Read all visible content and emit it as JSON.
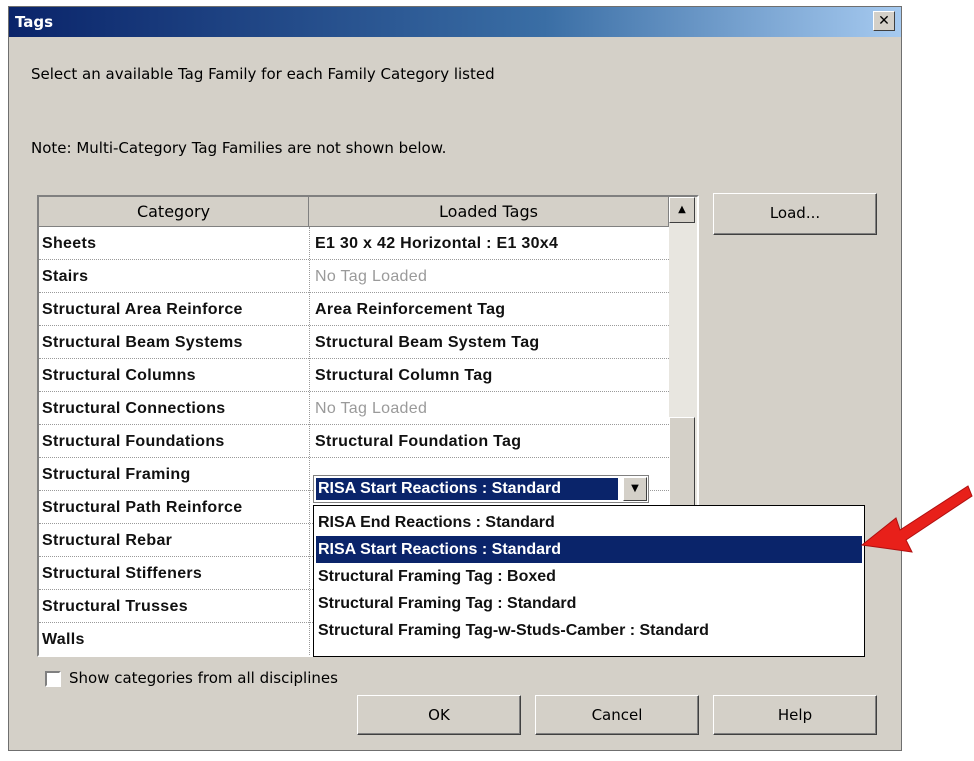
{
  "window": {
    "title": "Tags",
    "close_glyph": "✕"
  },
  "instructions": "Select an available Tag Family for each Family Category listed",
  "note": "Note: Multi-Category Tag Families are not shown below.",
  "table": {
    "headers": [
      "Category",
      "Loaded Tags"
    ],
    "rows": [
      {
        "category": "Sheets",
        "tag": "E1 30 x 42 Horizontal : E1 30x4"
      },
      {
        "category": "Stairs",
        "tag": "No Tag Loaded"
      },
      {
        "category": "Structural Area Reinforce",
        "tag": "Area Reinforcement Tag"
      },
      {
        "category": "Structural Beam Systems",
        "tag": "Structural Beam System Tag"
      },
      {
        "category": "Structural Columns",
        "tag": "Structural Column Tag"
      },
      {
        "category": "Structural Connections",
        "tag": "No Tag Loaded"
      },
      {
        "category": "Structural Foundations",
        "tag": "Structural Foundation Tag"
      },
      {
        "category": "Structural Framing",
        "tag": "RISA Start Reactions : Standard"
      },
      {
        "category": "Structural Path Reinforce",
        "tag": ""
      },
      {
        "category": "Structural Rebar",
        "tag": ""
      },
      {
        "category": "Structural Stiffeners",
        "tag": ""
      },
      {
        "category": "Structural Trusses",
        "tag": ""
      },
      {
        "category": "Walls",
        "tag": ""
      }
    ]
  },
  "combo": {
    "value": "RISA Start Reactions : Standard"
  },
  "dropdown": {
    "options": [
      "RISA End Reactions : Standard",
      "RISA Start Reactions : Standard",
      "Structural Framing Tag : Boxed",
      "Structural Framing Tag : Standard",
      "Structural Framing Tag-w-Studs-Camber : Standard"
    ],
    "selected_index": 1
  },
  "buttons": {
    "load": "Load...",
    "ok": "OK",
    "cancel": "Cancel",
    "help": "Help"
  },
  "checkbox": {
    "label": "Show categories from all disciplines",
    "checked": false
  },
  "colors": {
    "selection": "#0a246a",
    "arrow": "#e8201a",
    "dialog_bg": "#d4d0c8"
  },
  "icons": {
    "scroll_up": "▲",
    "combo_down": "▼"
  }
}
